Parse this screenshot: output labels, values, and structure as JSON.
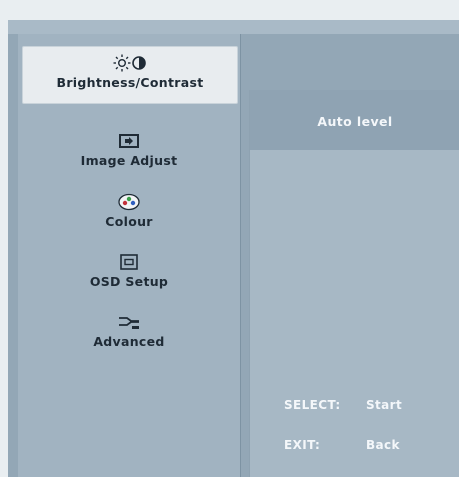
{
  "menu": {
    "items": [
      {
        "label": "Brightness/Contrast",
        "icon": "brightness-contrast-icon",
        "selected": true
      },
      {
        "label": "Image Adjust",
        "icon": "image-adjust-icon",
        "selected": false
      },
      {
        "label": "Colour",
        "icon": "colour-icon",
        "selected": false
      },
      {
        "label": "OSD Setup",
        "icon": "osd-setup-icon",
        "selected": false
      },
      {
        "label": "Advanced",
        "icon": "advanced-icon",
        "selected": false
      }
    ]
  },
  "panel": {
    "title": "Auto level",
    "hints": [
      {
        "key": "SELECT:",
        "action": "Start"
      },
      {
        "key": "EXIT:",
        "action": "Back"
      }
    ]
  },
  "colors": {
    "background": "#93a7b6",
    "selected_item": "#e8ecef",
    "text_dark": "#1f2b36",
    "text_light": "#f4f7fa"
  }
}
